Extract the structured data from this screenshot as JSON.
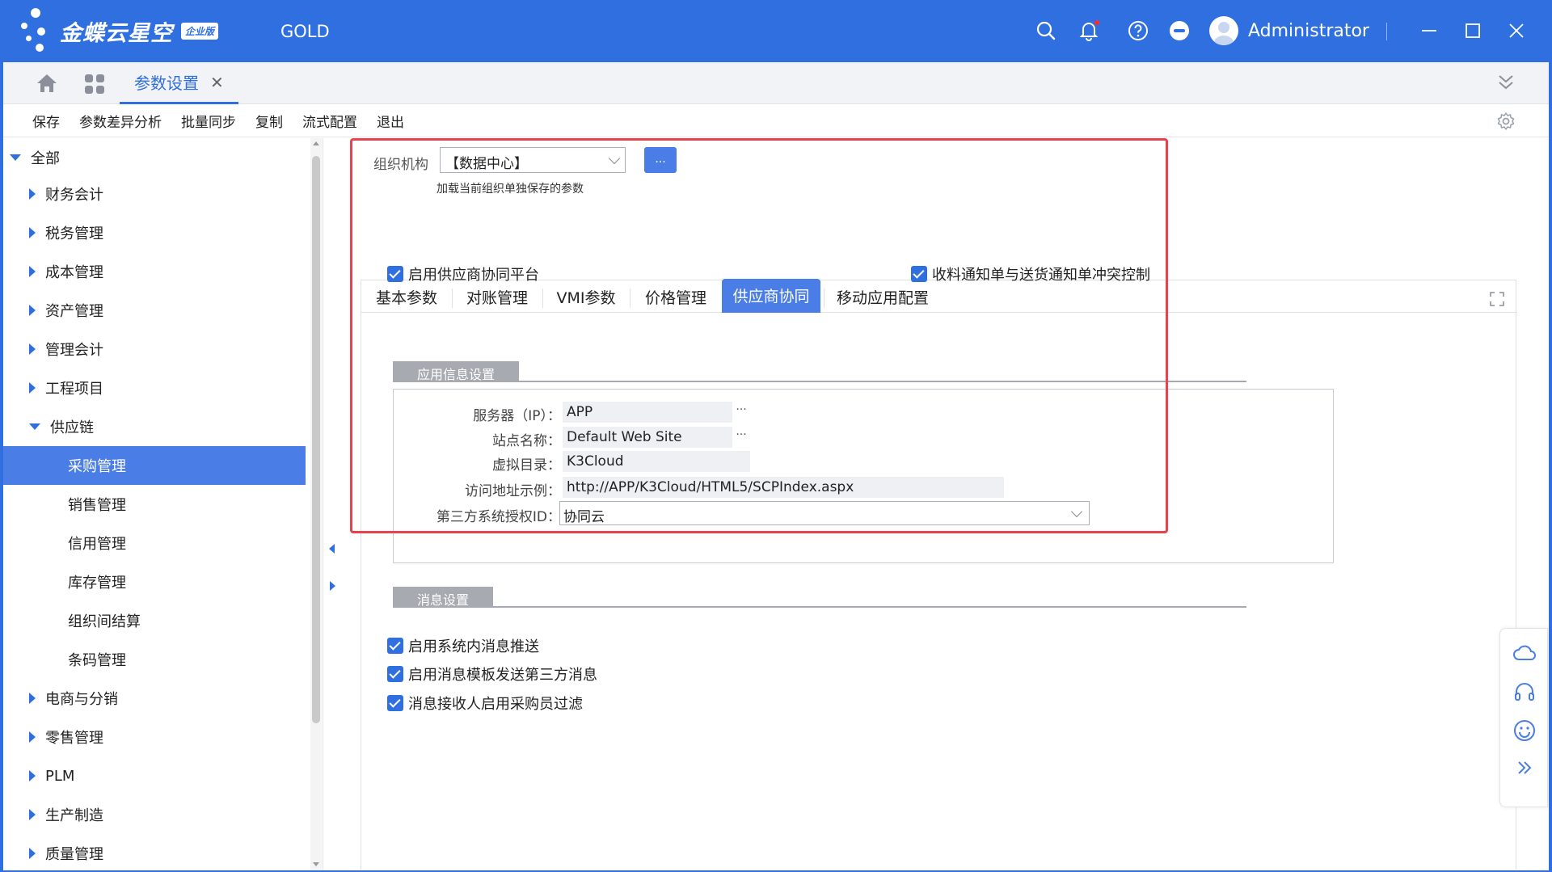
{
  "app": {
    "brand": "金蝶云星空",
    "edition_badge": "企业版",
    "database": "GOLD",
    "user": "Administrator"
  },
  "tabs": {
    "active_label": "参数设置",
    "close_glyph": "✕"
  },
  "toolbar": {
    "save": "保存",
    "diff": "参数差异分析",
    "sync": "批量同步",
    "copy": "复制",
    "flow": "流式配置",
    "exit": "退出"
  },
  "tree": {
    "root": "全部",
    "items": [
      {
        "label": "财务会计",
        "level": 1,
        "state": "collapsed"
      },
      {
        "label": "税务管理",
        "level": 1,
        "state": "collapsed"
      },
      {
        "label": "成本管理",
        "level": 1,
        "state": "collapsed"
      },
      {
        "label": "资产管理",
        "level": 1,
        "state": "collapsed"
      },
      {
        "label": "管理会计",
        "level": 1,
        "state": "collapsed"
      },
      {
        "label": "工程项目",
        "level": 1,
        "state": "collapsed"
      },
      {
        "label": "供应链",
        "level": 1,
        "state": "expanded"
      },
      {
        "label": "采购管理",
        "level": 2,
        "selected": true
      },
      {
        "label": "销售管理",
        "level": 2
      },
      {
        "label": "信用管理",
        "level": 2
      },
      {
        "label": "库存管理",
        "level": 2
      },
      {
        "label": "组织间结算",
        "level": 2
      },
      {
        "label": "条码管理",
        "level": 2
      },
      {
        "label": "电商与分销",
        "level": 1,
        "state": "collapsed"
      },
      {
        "label": "零售管理",
        "level": 1,
        "state": "collapsed"
      },
      {
        "label": "PLM",
        "level": 1,
        "state": "collapsed"
      },
      {
        "label": "生产制造",
        "level": 1,
        "state": "collapsed"
      },
      {
        "label": "质量管理",
        "level": 1,
        "state": "collapsed"
      }
    ]
  },
  "org": {
    "label": "组织机构",
    "value": "【数据中心】",
    "button": "...",
    "hint": "加载当前组织单独保存的参数"
  },
  "param_tabs": [
    {
      "label": "基本参数"
    },
    {
      "label": "对账管理"
    },
    {
      "label": "VMI参数"
    },
    {
      "label": "价格管理"
    },
    {
      "label": "供应商协同",
      "active": true
    },
    {
      "label": "移动应用配置"
    }
  ],
  "checks_top": {
    "enable_platform": "启用供应商协同平台",
    "conflict_control": "收料通知单与送货通知单冲突控制"
  },
  "app_info": {
    "section": "应用信息设置",
    "server_label": "服务器（IP）：",
    "server_value": "APP",
    "site_label": "站点名称：",
    "site_value": "Default Web Site",
    "vdir_label": "虚拟目录：",
    "vdir_value": "K3Cloud",
    "url_label": "访问地址示例：",
    "url_value": "http://APP/K3Cloud/HTML5/SCPIndex.aspx",
    "auth_label": "第三方系统授权ID：",
    "auth_value": "协同云",
    "ellipsis": "···"
  },
  "message": {
    "section": "消息设置",
    "push": "启用系统内消息推送",
    "template": "启用消息模板发送第三方消息",
    "filter": "消息接收人启用采购员过滤"
  },
  "colors": {
    "brand_blue": "#2f6fe0",
    "highlight_red": "#e8424f"
  }
}
